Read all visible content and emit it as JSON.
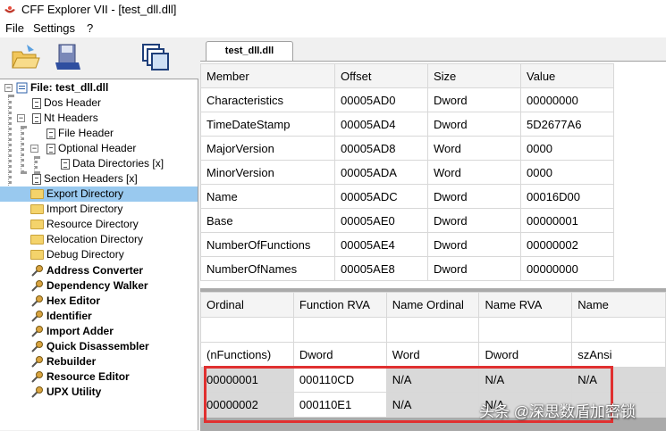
{
  "window": {
    "title": "CFF Explorer VII - [test_dll.dll]"
  },
  "menu": {
    "items": [
      "File",
      "Settings",
      "?"
    ]
  },
  "toolbar": {
    "buttons": [
      "open-icon",
      "save-icon",
      "windows-icon"
    ]
  },
  "tab": {
    "label": "test_dll.dll"
  },
  "tree": {
    "items": [
      {
        "label": "File: test_dll.dll",
        "bold": true,
        "icon": "file-icon"
      },
      {
        "label": "Dos Header",
        "icon": "doc-icon"
      },
      {
        "label": "Nt Headers",
        "icon": "doc-icon"
      },
      {
        "label": "File Header",
        "icon": "doc-icon"
      },
      {
        "label": "Optional Header",
        "icon": "doc-icon"
      },
      {
        "label": "Data Directories [x]",
        "icon": "doc-icon"
      },
      {
        "label": "Section Headers [x]",
        "icon": "doc-icon"
      },
      {
        "label": "Export Directory",
        "icon": "folder-icon",
        "selected": true
      },
      {
        "label": "Import Directory",
        "icon": "folder-icon"
      },
      {
        "label": "Resource Directory",
        "icon": "folder-icon"
      },
      {
        "label": "Relocation Directory",
        "icon": "folder-icon"
      },
      {
        "label": "Debug Directory",
        "icon": "folder-icon"
      },
      {
        "label": "Address Converter",
        "bold": true,
        "icon": "tool-icon"
      },
      {
        "label": "Dependency Walker",
        "bold": true,
        "icon": "tool-icon"
      },
      {
        "label": "Hex Editor",
        "bold": true,
        "icon": "tool-icon"
      },
      {
        "label": "Identifier",
        "bold": true,
        "icon": "tool-icon"
      },
      {
        "label": "Import Adder",
        "bold": true,
        "icon": "tool-icon"
      },
      {
        "label": "Quick Disassembler",
        "bold": true,
        "icon": "tool-icon"
      },
      {
        "label": "Rebuilder",
        "bold": true,
        "icon": "tool-icon"
      },
      {
        "label": "Resource Editor",
        "bold": true,
        "icon": "tool-icon"
      },
      {
        "label": "UPX Utility",
        "bold": true,
        "icon": "tool-icon"
      }
    ]
  },
  "export_table": {
    "headers": [
      "Member",
      "Offset",
      "Size",
      "Value"
    ],
    "rows": [
      [
        "Characteristics",
        "00005AD0",
        "Dword",
        "00000000"
      ],
      [
        "TimeDateStamp",
        "00005AD4",
        "Dword",
        "5D2677A6"
      ],
      [
        "MajorVersion",
        "00005AD8",
        "Word",
        "0000"
      ],
      [
        "MinorVersion",
        "00005ADA",
        "Word",
        "0000"
      ],
      [
        "Name",
        "00005ADC",
        "Dword",
        "00016D00"
      ],
      [
        "Base",
        "00005AE0",
        "Dword",
        "00000001"
      ],
      [
        "NumberOfFunctions",
        "00005AE4",
        "Dword",
        "00000002"
      ],
      [
        "NumberOfNames",
        "00005AE8",
        "Dword",
        "00000000"
      ]
    ]
  },
  "functions_table": {
    "headers": [
      "Ordinal",
      "Function RVA",
      "Name Ordinal",
      "Name RVA",
      "Name"
    ],
    "subheaders": [
      "(nFunctions)",
      "Dword",
      "Word",
      "Dword",
      "szAnsi"
    ],
    "rows": [
      [
        "00000001",
        "000110CD",
        "N/A",
        "N/A",
        "N/A"
      ],
      [
        "00000002",
        "000110E1",
        "N/A",
        "N/A",
        ""
      ]
    ]
  },
  "watermark": "头条 @深思数盾加密锁",
  "colors": {
    "selection": "#99c9ef",
    "highlight_box": "#e03030"
  }
}
